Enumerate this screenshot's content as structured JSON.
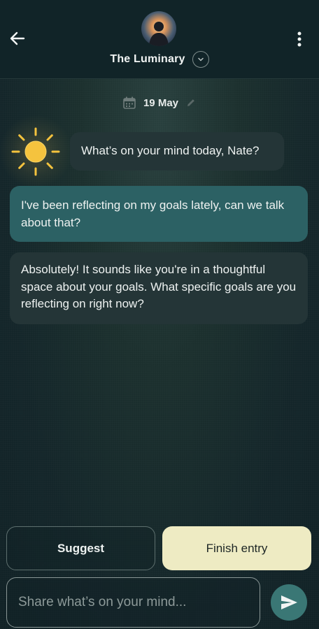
{
  "header": {
    "title": "The Luminary",
    "back_icon": "arrow-left-icon",
    "menu_icon": "more-vertical-icon",
    "dropdown_icon": "chevron-down-icon",
    "avatar_icon": "person-silhouette-icon"
  },
  "date": {
    "label": "19 May",
    "calendar_icon": "calendar-icon",
    "edit_icon": "pencil-icon"
  },
  "messages": [
    {
      "sender": "assistant",
      "text": "What’s on your mind today, Nate?"
    },
    {
      "sender": "user",
      "text": "I've been reflecting on my goals lately, can we talk about that?"
    },
    {
      "sender": "assistant",
      "text": "Absolutely! It sounds like you're in a thoughtful space about your goals. What specific goals are you reflecting on right now?"
    }
  ],
  "actions": {
    "suggest_label": "Suggest",
    "finish_label": "Finish entry"
  },
  "composer": {
    "value": "",
    "placeholder": "Share what’s on your mind...",
    "send_icon": "send-icon"
  },
  "colors": {
    "background": "#14262a",
    "header": "#112428",
    "assistant_bubble": "#243537",
    "user_bubble": "#2c6164",
    "finish_button": "#eeebc3",
    "send_button": "#3a7775",
    "sun": "#f5c33e"
  }
}
